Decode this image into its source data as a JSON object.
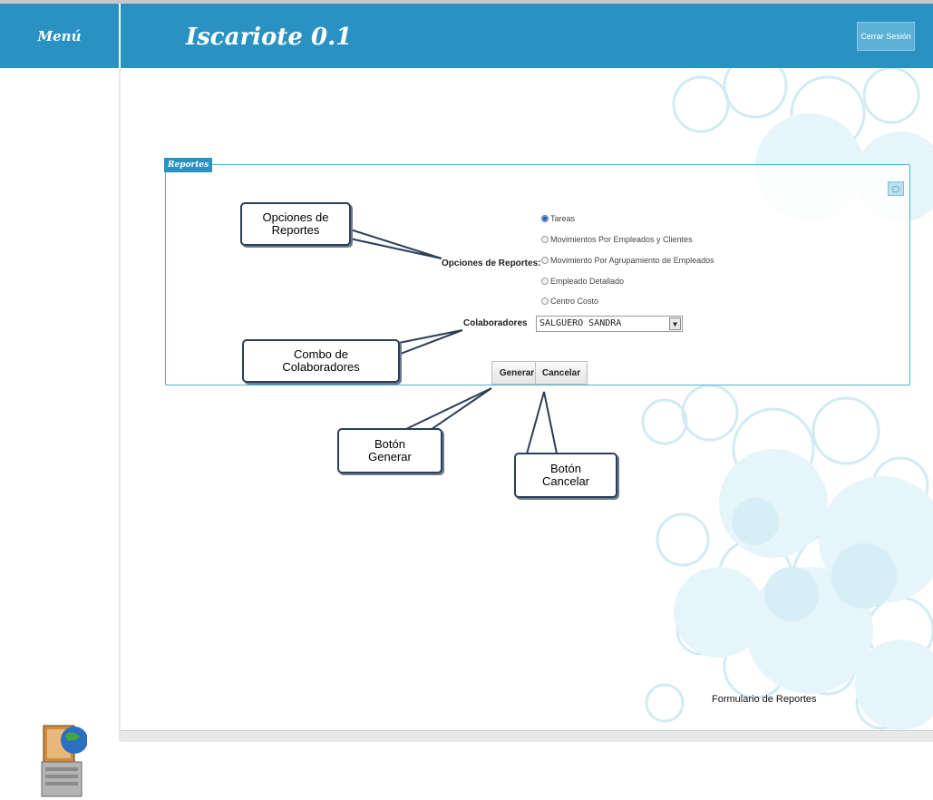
{
  "header": {
    "menu_label": "Menú",
    "app_title": "Iscariote 0.1",
    "logout_label": "Cerrar Sesión"
  },
  "panel": {
    "legend": "Reportes",
    "options_label": "Opciones de Reportes:",
    "options": [
      {
        "label": "Tareas",
        "checked": true
      },
      {
        "label": "Movimientos Por Empleados y Clientes",
        "checked": false
      },
      {
        "label": "Movimiento Por Agrupamiento de Empleados",
        "checked": false
      },
      {
        "label": "Empleado Detallado",
        "checked": false
      },
      {
        "label": "Centro Costo",
        "checked": false
      }
    ],
    "collaborators_label": "Colaboradores",
    "collaborators_value": "SALGUERO SANDRA",
    "generate_label": "Generar",
    "cancel_label": "Cancelar"
  },
  "callouts": {
    "options": "Opciones de Reportes",
    "combo": "Combo de Colaboradores",
    "generate": "Botón Generar",
    "cancel": "Botón Cancelar"
  },
  "footer": {
    "caption": "Formulario de Reportes"
  },
  "colors": {
    "header_blue": "#2a92c2",
    "panel_border": "#4fb2d1",
    "bubble_tint": "#d6eef5"
  }
}
